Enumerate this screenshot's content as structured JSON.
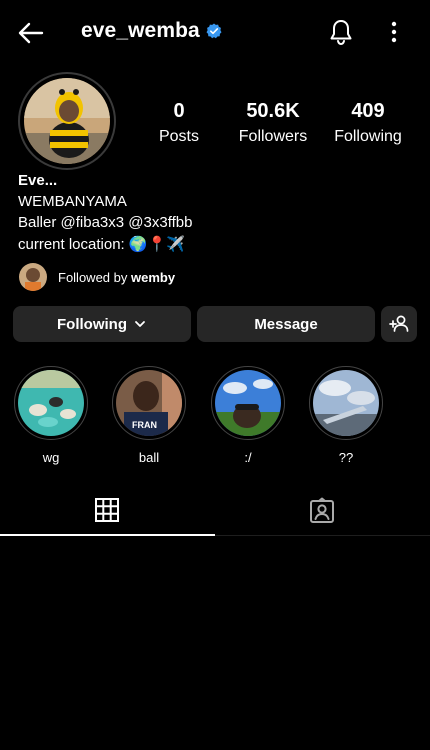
{
  "header": {
    "username": "eve_wemba",
    "verified": true,
    "icons": [
      "back-arrow-icon",
      "verified-badge-icon",
      "bell-icon",
      "more-vertical-icon"
    ]
  },
  "stats": {
    "posts": {
      "value": "0",
      "label": "Posts"
    },
    "followers": {
      "value": "50.6K",
      "label": "Followers"
    },
    "following": {
      "value": "409",
      "label": "Following"
    }
  },
  "bio": {
    "name": "Eve...",
    "line1": "WEMBANYAMA",
    "line2": "Baller @fiba3x3 @3x3ffbb",
    "line3": "current location: 🌍📍✈️"
  },
  "followed_by": {
    "prefix": "Followed by ",
    "user": "wemby"
  },
  "actions": {
    "following_label": "Following",
    "message_label": "Message"
  },
  "highlights": [
    {
      "label": "wg"
    },
    {
      "label": "ball"
    },
    {
      "label": ":/"
    },
    {
      "label": "??"
    }
  ],
  "tabs": [
    "grid-icon",
    "tagged-icon"
  ],
  "colors": {
    "background": "#000000",
    "button": "#262626",
    "verified": "#3897f0",
    "text": "#ffffff"
  }
}
